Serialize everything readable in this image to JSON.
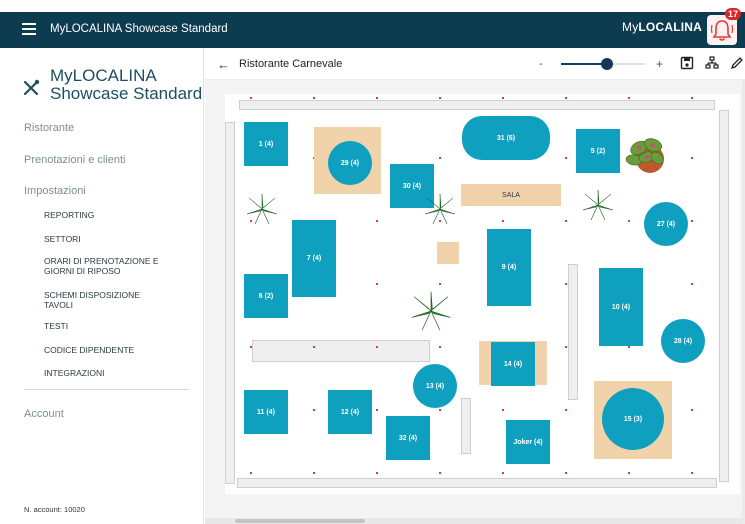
{
  "header": {
    "app_title": "MyLOCALINA Showcase Standard",
    "brand_light": "My",
    "brand_bold": "LOCALINA",
    "notifications": "17"
  },
  "sidebar": {
    "company_line1": "MyLOCALINA",
    "company_line2": "Showcase Standard",
    "sections": [
      "Ristorante",
      "Prenotazioni e clienti",
      "Impostazioni"
    ],
    "settings_items": [
      "REPORTING",
      "SETTORI",
      "ORARI DI PRENOTAZIONE E GIORNI DI RIPOSO",
      "SCHEMI DISPOSIZIONE TAVOLI",
      "TESTI",
      "CODICE DIPENDENTE",
      "INTEGRAZIONI"
    ],
    "account_label": "Account",
    "account_number": "N. account: 10020"
  },
  "toolbar": {
    "room_name": "Ristorante Carnevale",
    "zoom_minus": "-",
    "zoom_plus": "+",
    "zoom_level": 0.55
  },
  "floor": {
    "sala_label": "SALA",
    "tables": [
      {
        "name": "1 (4)",
        "shape": "square"
      },
      {
        "name": "29 (4)",
        "shape": "round"
      },
      {
        "name": "30 (4)",
        "shape": "square"
      },
      {
        "name": "31 (6)",
        "shape": "pill"
      },
      {
        "name": "5 (2)",
        "shape": "square"
      },
      {
        "name": "27 (4)",
        "shape": "round"
      },
      {
        "name": "7 (4)",
        "shape": "square"
      },
      {
        "name": "9 (4)",
        "shape": "square"
      },
      {
        "name": "6 (2)",
        "shape": "square"
      },
      {
        "name": "10 (4)",
        "shape": "square"
      },
      {
        "name": "28 (4)",
        "shape": "round"
      },
      {
        "name": "14 (4)",
        "shape": "square"
      },
      {
        "name": "13 (4)",
        "shape": "round"
      },
      {
        "name": "11 (4)",
        "shape": "square"
      },
      {
        "name": "12 (4)",
        "shape": "square"
      },
      {
        "name": "32 (4)",
        "shape": "square"
      },
      {
        "name": "15 (3)",
        "shape": "round"
      },
      {
        "name": "Joker (4)",
        "shape": "square"
      }
    ]
  },
  "colors": {
    "topbar": "#0d3b4f",
    "table": "#0f9fbf",
    "tile": "#f0d2ab",
    "badge": "#d9262b"
  },
  "icons": [
    "menu-icon",
    "bell-icon",
    "utensils-icon",
    "back-arrow-icon",
    "save-icon",
    "sitemap-icon",
    "pencil-icon",
    "plant-icon"
  ]
}
